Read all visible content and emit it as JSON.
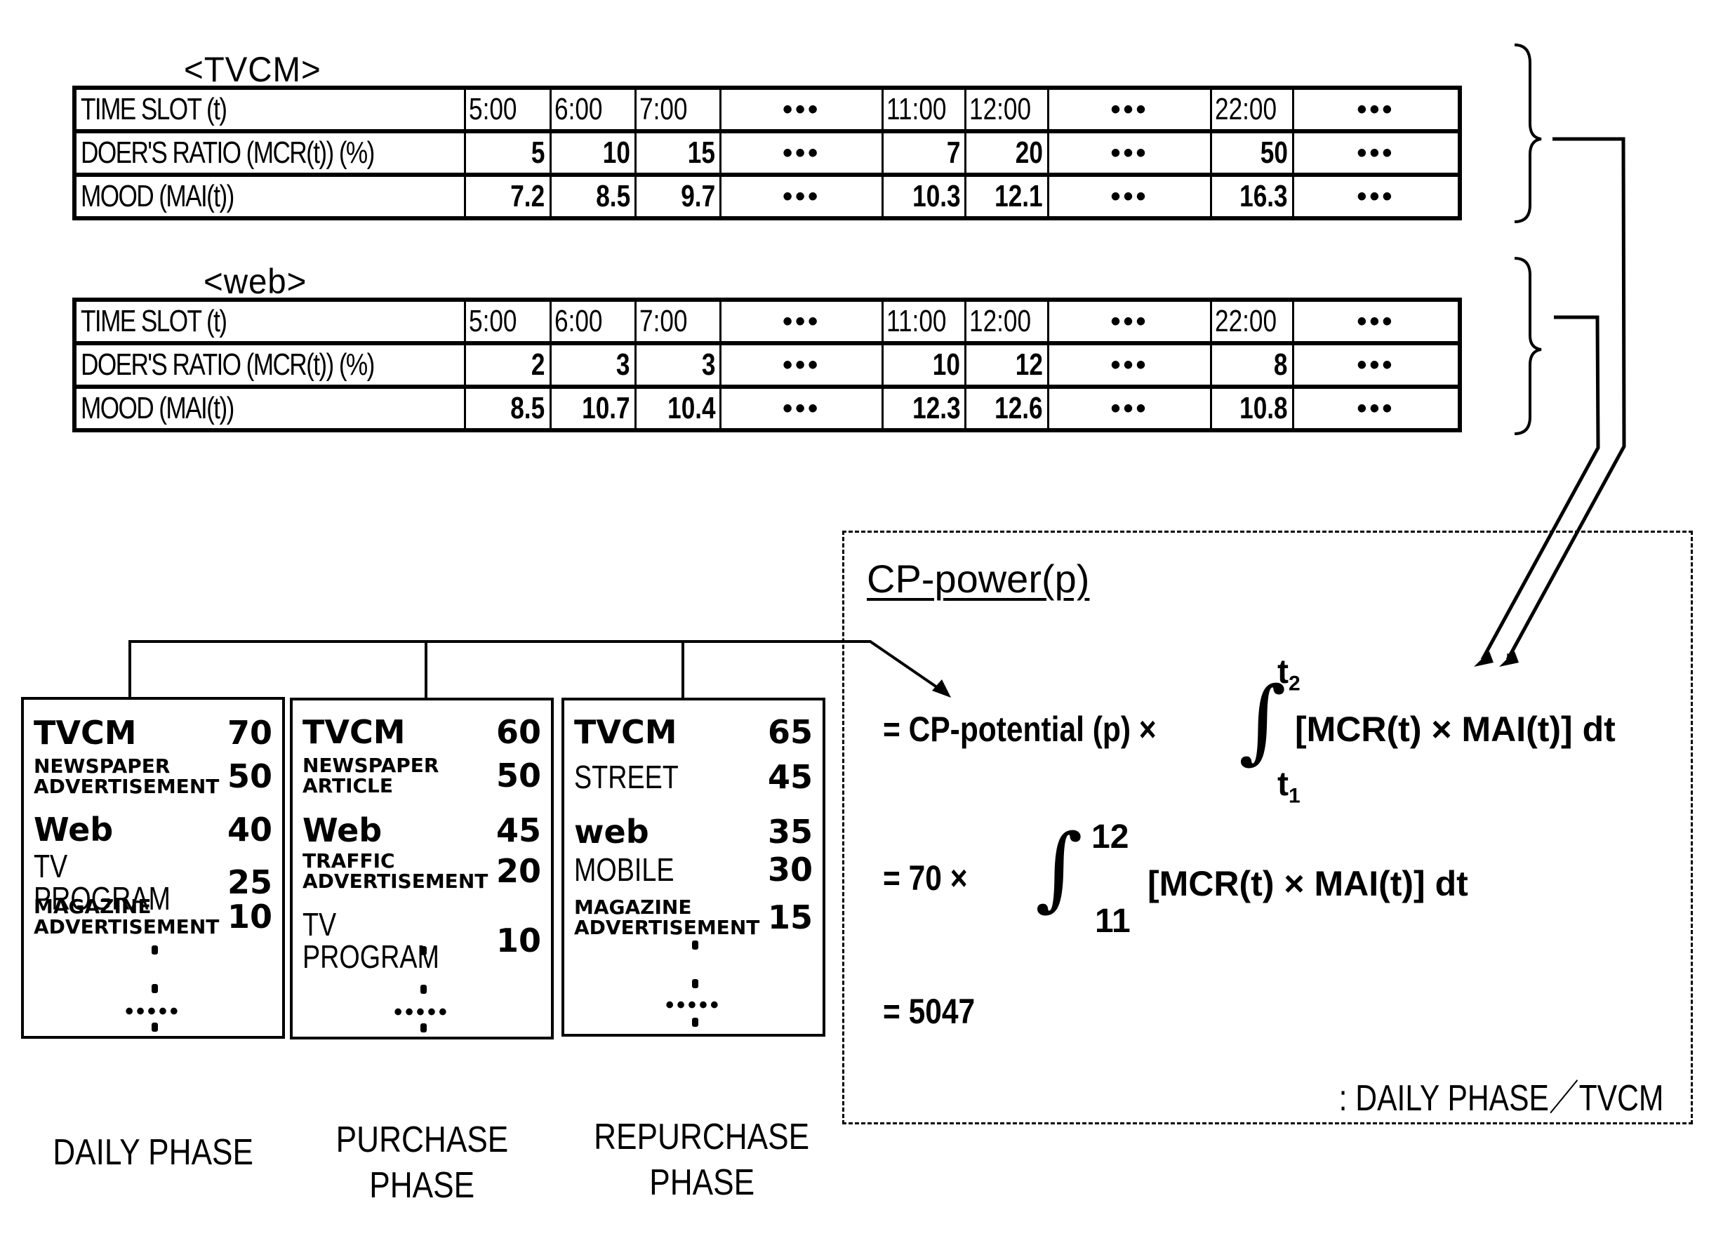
{
  "tables": [
    {
      "title": "<TVCM>",
      "row_labels": [
        "TIME SLOT (t)",
        "DOER'S RATIO (MCR(t)) (%)",
        "MOOD (MAI(t))"
      ],
      "time_slots": [
        "5:00",
        "6:00",
        "7:00",
        "•••",
        "11:00",
        "12:00",
        "•••",
        "22:00",
        "•••"
      ],
      "doers_ratio": [
        "5",
        "10",
        "15",
        "•••",
        "7",
        "20",
        "•••",
        "50",
        "•••"
      ],
      "mood": [
        "7.2",
        "8.5",
        "9.7",
        "•••",
        "10.3",
        "12.1",
        "•••",
        "16.3",
        "•••"
      ]
    },
    {
      "title": "<web>",
      "row_labels": [
        "TIME SLOT (t)",
        "DOER'S RATIO (MCR(t)) (%)",
        "MOOD (MAI(t))"
      ],
      "time_slots": [
        "5:00",
        "6:00",
        "7:00",
        "•••",
        "11:00",
        "12:00",
        "•••",
        "22:00",
        "•••"
      ],
      "doers_ratio": [
        "2",
        "3",
        "3",
        "•••",
        "10",
        "12",
        "•••",
        "8",
        "•••"
      ],
      "mood": [
        "8.5",
        "10.7",
        "10.4",
        "•••",
        "12.3",
        "12.6",
        "•••",
        "10.8",
        "•••"
      ]
    }
  ],
  "phases": [
    {
      "label_lines": [
        "DAILY PHASE"
      ],
      "items": [
        {
          "name": [
            "TVCM"
          ],
          "value": "70"
        },
        {
          "name": [
            "NEWSPAPER",
            "ADVERTISEMENT"
          ],
          "value": "50"
        },
        {
          "name": [
            "Web"
          ],
          "value": "40"
        },
        {
          "name": [
            "TV PROGRAM"
          ],
          "value": "25"
        },
        {
          "name": [
            "MAGAZINE",
            "ADVERTISEMENT"
          ],
          "value": "10"
        }
      ],
      "ellipsis": "•••••"
    },
    {
      "label_lines": [
        "PURCHASE",
        "PHASE"
      ],
      "items": [
        {
          "name": [
            "TVCM"
          ],
          "value": "60"
        },
        {
          "name": [
            "NEWSPAPER",
            "ARTICLE"
          ],
          "value": "50"
        },
        {
          "name": [
            "Web"
          ],
          "value": "45"
        },
        {
          "name": [
            "TRAFFIC",
            "ADVERTISEMENT"
          ],
          "value": "20"
        },
        {
          "name": [
            "TV PROGRAM"
          ],
          "value": "10"
        }
      ],
      "ellipsis": "•••••"
    },
    {
      "label_lines": [
        "REPURCHASE",
        "PHASE"
      ],
      "items": [
        {
          "name": [
            "TVCM"
          ],
          "value": "65"
        },
        {
          "name": [
            "STREET"
          ],
          "value": "45"
        },
        {
          "name": [
            "web"
          ],
          "value": "35"
        },
        {
          "name": [
            "MOBILE"
          ],
          "value": "30"
        },
        {
          "name": [
            "MAGAZINE",
            "ADVERTISEMENT"
          ],
          "value": "15"
        }
      ],
      "ellipsis": "•••••"
    }
  ],
  "formula": {
    "title": "CP-power(p)",
    "line1_prefix": "= CP-potential (p)  ×",
    "line1_upper": "t2",
    "line1_lower": "t1",
    "integrand": "[MCR(t) × MAI(t)] dt",
    "line2_prefix": "= 70   ×",
    "line2_upper": "12",
    "line2_lower": "11",
    "result": "= 5047",
    "note": ": DAILY PHASE／TVCM",
    "integral_symbol": "∫"
  }
}
